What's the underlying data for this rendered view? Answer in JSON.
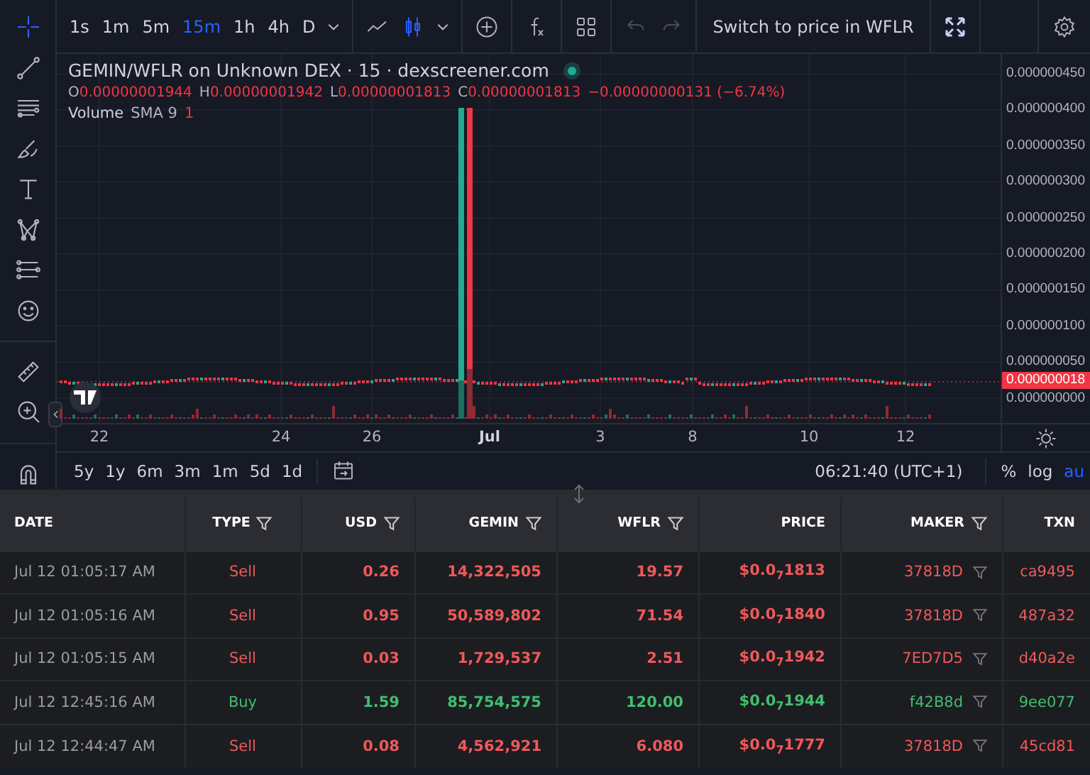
{
  "drawing_tools": [
    {
      "selected": true
    },
    {
      "selected": false
    },
    {
      "selected": false
    },
    {
      "selected": false
    },
    {
      "selected": false
    },
    {
      "selected": false
    },
    {
      "selected": false
    },
    {
      "selected": false
    },
    {
      "selected": false
    },
    {
      "selected": false
    },
    {
      "selected": false
    }
  ],
  "toolbar": {
    "intervals": [
      {
        "label": "1s",
        "selected": false
      },
      {
        "label": "1m",
        "selected": false
      },
      {
        "label": "5m",
        "selected": false
      },
      {
        "label": "15m",
        "selected": true
      },
      {
        "label": "1h",
        "selected": false
      },
      {
        "label": "4h",
        "selected": false
      },
      {
        "label": "D",
        "selected": false
      }
    ],
    "chart_styles": [
      {
        "selected": false
      },
      {
        "selected": true
      }
    ],
    "history": [
      {
        "disabled": true
      },
      {
        "disabled": true
      }
    ],
    "switch_button": "Switch to price in WFLR"
  },
  "legend": {
    "title": "GEMIN/WFLR on Unknown DEX · 15 · dexscreener.com",
    "live": true,
    "ohlc": [
      {
        "key": "O",
        "value": "0.00000001944"
      },
      {
        "key": "H",
        "value": "0.00000001942"
      },
      {
        "key": "L",
        "value": "0.00000001813"
      },
      {
        "key": "C",
        "value": "0.00000001813"
      }
    ],
    "change": "−0.00000000131 (−6.74%)",
    "volume_label": "Volume",
    "volume_sma": "SMA 9",
    "volume_value": "1"
  },
  "price_axis": {
    "ticks": [
      "0.000000450",
      "0.000000400",
      "0.000000350",
      "0.000000300",
      "0.000000250",
      "0.000000200",
      "0.000000150",
      "0.000000100",
      "0.000000050",
      "0.000000000"
    ],
    "last_price": "0.000000018"
  },
  "time_axis": {
    "labels": [
      {
        "label": "22",
        "kind": "day"
      },
      {
        "label": "24",
        "kind": "day"
      },
      {
        "label": "26",
        "kind": "day"
      },
      {
        "label": "Jul",
        "kind": "month"
      },
      {
        "label": "3",
        "kind": "day"
      },
      {
        "label": "8",
        "kind": "day"
      },
      {
        "label": "10",
        "kind": "day"
      },
      {
        "label": "12",
        "kind": "day"
      }
    ]
  },
  "range_bar": {
    "ranges": [
      "5y",
      "1y",
      "6m",
      "3m",
      "1m",
      "5d",
      "1d"
    ],
    "clock": "06:21:40 (UTC+1)",
    "scale_options": [
      {
        "label": "%",
        "selected": false
      },
      {
        "label": "log",
        "selected": false
      },
      {
        "label": "au",
        "selected": true
      }
    ]
  },
  "table": {
    "columns": [
      {
        "label": "DATE",
        "filter": false
      },
      {
        "label": "TYPE",
        "filter": true
      },
      {
        "label": "USD",
        "filter": true
      },
      {
        "label": "GEMIN",
        "filter": true
      },
      {
        "label": "WFLR",
        "filter": true
      },
      {
        "label": "PRICE",
        "filter": false
      },
      {
        "label": "MAKER",
        "filter": true
      },
      {
        "label": "TXN",
        "filter": false
      }
    ],
    "rows": [
      {
        "kind": "sell",
        "date": "Jul 12 01:05:17 AM",
        "type": "Sell",
        "usd": "0.26",
        "gemin": "14,322,505",
        "wflr": "19.57",
        "price": "$0.0$_{7}$1813",
        "maker": "37818D",
        "txn": "ca9495"
      },
      {
        "kind": "sell",
        "date": "Jul 12 01:05:16 AM",
        "type": "Sell",
        "usd": "0.95",
        "gemin": "50,589,802",
        "wflr": "71.54",
        "price": "$0.0$_{7}$1840",
        "maker": "37818D",
        "txn": "487a32"
      },
      {
        "kind": "sell",
        "date": "Jul 12 01:05:15 AM",
        "type": "Sell",
        "usd": "0.03",
        "gemin": "1,729,537",
        "wflr": "2.51",
        "price": "$0.0$_{7}$1942",
        "maker": "7ED7D5",
        "txn": "d40a2e"
      },
      {
        "kind": "buy",
        "date": "Jul 12 12:45:16 AM",
        "type": "Buy",
        "usd": "1.59",
        "gemin": "85,754,575",
        "wflr": "120.00",
        "price": "$0.0$_{7}$1944",
        "maker": "f42B8d",
        "txn": "9ee077"
      },
      {
        "kind": "sell",
        "date": "Jul 12 12:44:47 AM",
        "type": "Sell",
        "usd": "0.08",
        "gemin": "4,562,921",
        "wflr": "6.080",
        "price": "$0.0$_{7}$1777",
        "maker": "37818D",
        "txn": "45cd81"
      }
    ]
  }
}
